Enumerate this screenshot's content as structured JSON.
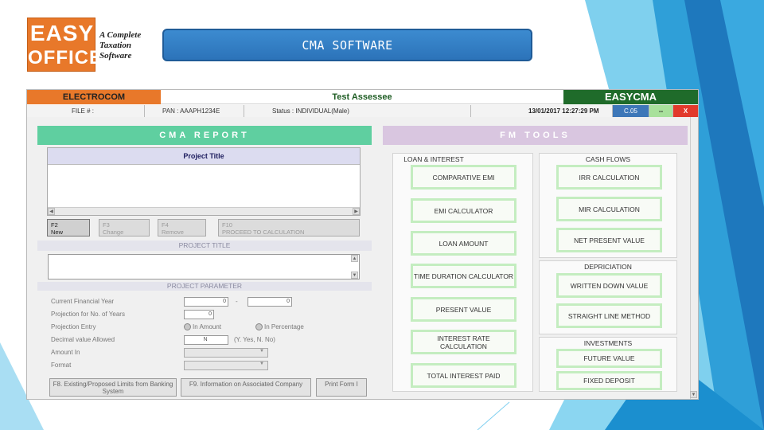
{
  "logo": {
    "line1": "EASY",
    "line2": "OFFICE",
    "tagline": [
      "A Complete",
      "Taxation",
      "Software"
    ]
  },
  "slide_title": "CMA SOFTWARE",
  "app": {
    "header": {
      "company": "ELECTROCOM",
      "assessee": "Test Assessee",
      "brand": "EASYCMA"
    },
    "info": {
      "file": "FILE # :",
      "pan": "PAN : AAAPH1234E",
      "status": "Status : INDIVIDUAL(Male)",
      "datetime": "13/01/2017 12:27:29 PM",
      "code": "C.05",
      "minimize": "--",
      "close": "X"
    },
    "cma_report": {
      "heading": "CMA REPORT",
      "column_header": "Project Title",
      "buttons": [
        {
          "key": "F2",
          "label": "New"
        },
        {
          "key": "F3",
          "label": "Change"
        },
        {
          "key": "F4",
          "label": "Remove"
        },
        {
          "key": "F10",
          "label": "PROCEED TO CALCULATION"
        }
      ],
      "project_title_label": "PROJECT TITLE",
      "project_parameter_label": "PROJECT PARAMETER",
      "fields": {
        "current_fy": "Current Financial Year",
        "fy_from": "0",
        "fy_sep": "-",
        "fy_to": "0",
        "projection_years": "Projection for No. of Years",
        "projection_years_value": "0",
        "projection_entry": "Projection Entry",
        "in_amount": "In Amount",
        "in_percentage": "In Percentage",
        "decimal_allowed": "Decimal value Allowed",
        "decimal_value": "N",
        "decimal_hint": "(Y. Yes, N. No)",
        "amount_in": "Amount In",
        "format": "Format"
      },
      "bottom_buttons": [
        "F8. Existing/Proposed Limits from Banking System",
        "F9. Information on Associated Company",
        "Print Form I"
      ]
    },
    "fm_tools": {
      "heading": "FM TOOLS",
      "loan_interest": {
        "title": "LOAN & INTEREST",
        "items": [
          "COMPARATIVE EMI",
          "EMI CALCULATOR",
          "LOAN AMOUNT",
          "TIME DURATION CALCULATOR",
          "PRESENT VALUE",
          "INTEREST RATE CALCULATION",
          "TOTAL INTEREST PAID"
        ]
      },
      "cash_flows": {
        "title": "CASH FLOWS",
        "items": [
          "IRR CALCULATION",
          "MIR CALCULATION",
          "NET PRESENT VALUE"
        ]
      },
      "depreciation": {
        "title": "DEPRICIATION",
        "items": [
          "WRITTEN DOWN VALUE",
          "STRAIGHT LINE METHOD"
        ]
      },
      "investments": {
        "title": "INVESTMENTS",
        "items": [
          "FUTURE VALUE",
          "FIXED DEPOSIT"
        ]
      }
    }
  },
  "colors": {
    "orange": "#e8782a",
    "green_dark": "#1f6b2a",
    "report_header": "#5fcfa0",
    "tools_header": "#d9c6e0",
    "banner_blue": "#2c73b9"
  }
}
